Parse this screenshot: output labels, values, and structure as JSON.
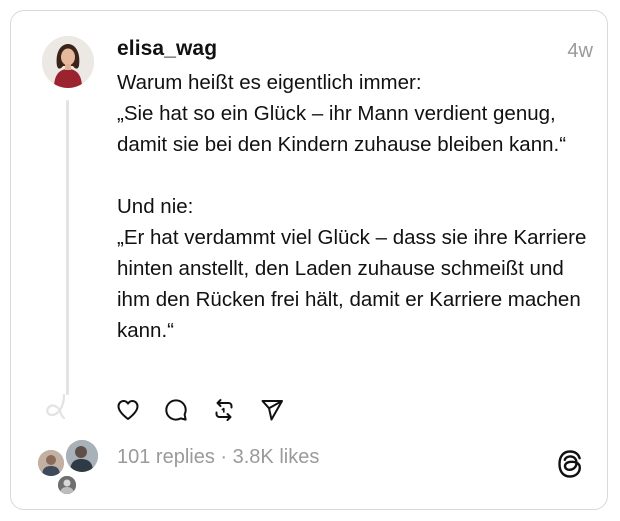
{
  "post": {
    "username": "elisa_wag",
    "time": "4w",
    "lines": [
      "Warum heißt es eigentlich immer:",
      "„Sie hat so ein Glück – ihr Mann verdient genug, damit sie bei den Kindern zuhause bleiben kann.“",
      "Und nie:",
      "„Er hat verdammt viel Glück – dass sie ihre Karriere hinten anstellt, den Laden zuhause schmeißt und ihm den Rücken frei hält, damit er Karriere machen kann.“"
    ],
    "stats": "101 replies · 3.8K likes"
  },
  "icons": {
    "like": "heart-icon",
    "reply": "comment-icon",
    "repost": "repost-icon",
    "share": "send-icon",
    "brand": "threads-logo-icon"
  },
  "colors": {
    "muted": "#9a9a9a",
    "border": "#d9d9d9",
    "text": "#111111"
  }
}
